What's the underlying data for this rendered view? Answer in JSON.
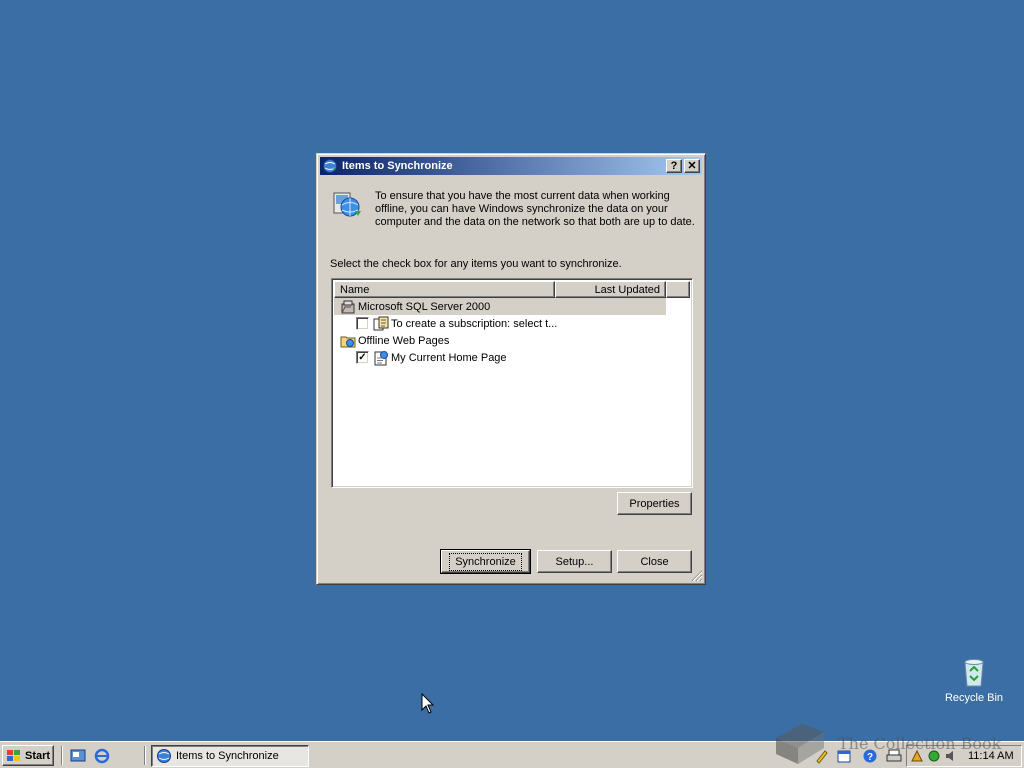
{
  "dialog": {
    "title": "Items to Synchronize",
    "help_glyph": "?",
    "close_glyph": "✕",
    "info_text": "To ensure that you have the most current data when working offline, you can have Windows synchronize the data on your computer and the data on the network so that both are up to date.",
    "instruction": "Select the check box for any items you want to synchronize.",
    "columns": {
      "name": "Name",
      "last_updated": "Last Updated"
    },
    "items": [
      {
        "label": "Microsoft SQL Server 2000",
        "type": "group",
        "icon": "sql-server-icon",
        "selected": true
      },
      {
        "label": "To create a subscription: select t...",
        "type": "item",
        "checked": false,
        "icon": "subscription-icon"
      },
      {
        "label": "Offline Web Pages",
        "type": "group",
        "icon": "offline-web-pages-icon"
      },
      {
        "label": "My Current Home Page",
        "type": "item",
        "checked": true,
        "icon": "web-page-icon"
      }
    ],
    "check_mark": "✓",
    "buttons": {
      "properties": "Properties",
      "synchronize": "Synchronize",
      "setup": "Setup...",
      "close": "Close"
    }
  },
  "desktop": {
    "recycle_bin": "Recycle Bin",
    "background_color": "#3a6ea5"
  },
  "taskbar": {
    "start": "Start",
    "task_button": "Items to Synchronize",
    "clock": "11:14 AM",
    "watermark": "The Collection Book"
  }
}
